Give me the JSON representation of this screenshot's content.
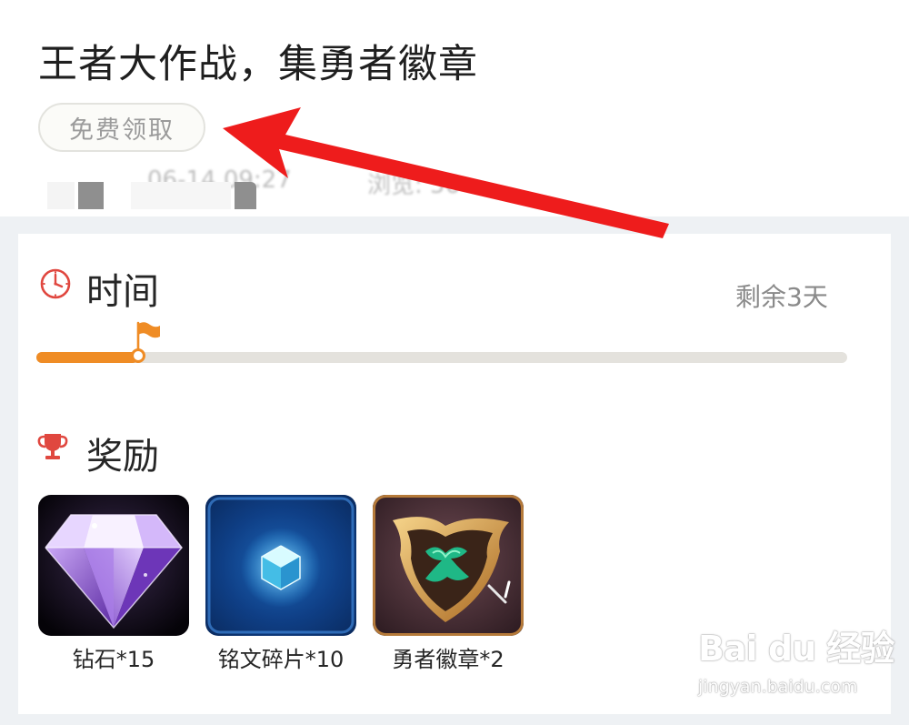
{
  "header": {
    "title": "王者大作战，集勇者徽章",
    "claim_label": "免费领取",
    "meta_date": "06-14 09:27",
    "meta_views": "浏览: 56"
  },
  "time_section": {
    "title": "时间",
    "remaining": "剩余3天",
    "progress_fraction": 0.125
  },
  "reward_section": {
    "title": "奖励",
    "items": [
      {
        "label": "钻石*15",
        "icon": "diamond-icon"
      },
      {
        "label": "铭文碎片*10",
        "icon": "inscription-fragment-icon"
      },
      {
        "label": "勇者徽章*2",
        "icon": "hero-badge-icon"
      }
    ]
  },
  "watermark": {
    "main": "Bai du 经验",
    "sub": "jingyan.baidu.com"
  },
  "colors": {
    "accent_orange": "#ef8c25",
    "annotation_red": "#ee1c1c",
    "icon_red": "#e0473f"
  }
}
